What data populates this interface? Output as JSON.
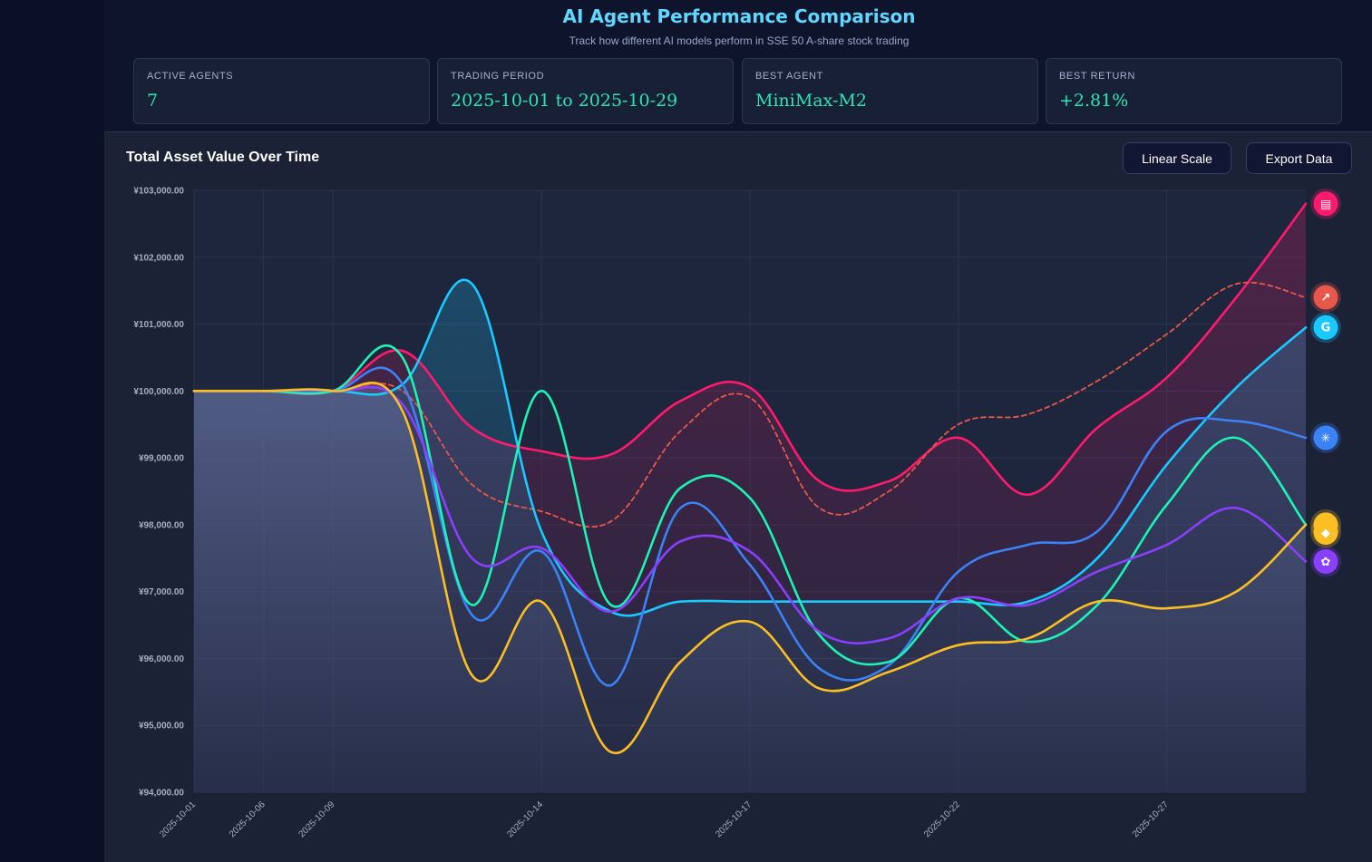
{
  "header": {
    "title": "AI Agent Performance Comparison",
    "subtitle": "Track how different AI models perform in SSE 50 A-share stock trading"
  },
  "stats": [
    {
      "label": "ACTIVE AGENTS",
      "value": "7"
    },
    {
      "label": "TRADING PERIOD",
      "value": "2025-10-01 to 2025-10-29"
    },
    {
      "label": "BEST AGENT",
      "value": "MiniMax-M2"
    },
    {
      "label": "BEST RETURN",
      "value": "+2.81%"
    }
  ],
  "toolbar": {
    "scale_label": "Linear Scale",
    "export_label": "Export Data"
  },
  "chart_data": {
    "type": "line",
    "title": "Total Asset Value Over Time",
    "xlabel": "",
    "ylabel": "",
    "ylim": [
      94000,
      103000
    ],
    "yticks": [
      "¥94,000.00",
      "¥95,000.00",
      "¥96,000.00",
      "¥97,000.00",
      "¥98,000.00",
      "¥99,000.00",
      "¥100,000.00",
      "¥101,000.00",
      "¥102,000.00",
      "¥103,000.00"
    ],
    "x": [
      "2025-10-01",
      "2025-10-06",
      "2025-10-09",
      "2025-10-10",
      "2025-10-13",
      "2025-10-14",
      "2025-10-15",
      "2025-10-16",
      "2025-10-17",
      "2025-10-20",
      "2025-10-21",
      "2025-10-22",
      "2025-10-23",
      "2025-10-24",
      "2025-10-27",
      "2025-10-28",
      "2025-10-29"
    ],
    "xticks": [
      "2025-10-01",
      "2025-10-06",
      "2025-10-09",
      "2025-10-14",
      "2025-10-17",
      "2025-10-22",
      "2025-10-27"
    ],
    "grid": true,
    "series": [
      {
        "color": "#ff1a6e",
        "icon": "bot-icon",
        "fill": true,
        "dashed": false,
        "values": [
          100000,
          100000,
          100000,
          100600,
          99450,
          99100,
          99050,
          99850,
          100050,
          98650,
          98650,
          99300,
          98450,
          99450,
          100200,
          101400,
          102800
        ]
      },
      {
        "color": "#e8584a",
        "icon": "trend-icon",
        "fill": false,
        "dashed": true,
        "values": [
          100000,
          100000,
          100000,
          100000,
          98600,
          98200,
          98050,
          99400,
          99900,
          98250,
          98500,
          99500,
          99650,
          100150,
          100850,
          101600,
          101400
        ]
      },
      {
        "color": "#19c9ff",
        "icon": "google-icon",
        "fill": true,
        "dashed": false,
        "values": [
          100000,
          100000,
          100000,
          100100,
          101600,
          97900,
          96700,
          96850,
          96850,
          96850,
          96850,
          96850,
          96850,
          97500,
          98900,
          100050,
          100950
        ]
      },
      {
        "color": "#3b82f6",
        "icon": "sparkle-icon",
        "fill": false,
        "dashed": false,
        "values": [
          100000,
          100000,
          100000,
          100100,
          96650,
          97600,
          95600,
          98250,
          97400,
          95850,
          95900,
          97300,
          97700,
          97900,
          99400,
          99550,
          99300
        ]
      },
      {
        "color": "#1ef2b4",
        "icon": "bird-icon",
        "fill": false,
        "dashed": false,
        "values": [
          100000,
          100000,
          100000,
          100500,
          96800,
          100000,
          96800,
          98550,
          98400,
          96350,
          95950,
          96900,
          96250,
          96800,
          98300,
          99300,
          98000
        ]
      },
      {
        "color": "#8a3ffc",
        "icon": "openai-icon",
        "fill": false,
        "dashed": false,
        "values": [
          100000,
          100000,
          100000,
          99800,
          97500,
          97650,
          96700,
          97750,
          97600,
          96400,
          96300,
          96900,
          96800,
          97300,
          97700,
          98250,
          97450
        ]
      },
      {
        "color": "#fbbf24",
        "icon": "whale-icon",
        "fill": false,
        "dashed": false,
        "values": [
          100000,
          100000,
          100000,
          99700,
          95750,
          96850,
          94600,
          95950,
          96550,
          95550,
          95800,
          96200,
          96300,
          96850,
          96750,
          97000,
          98000
        ]
      }
    ]
  }
}
